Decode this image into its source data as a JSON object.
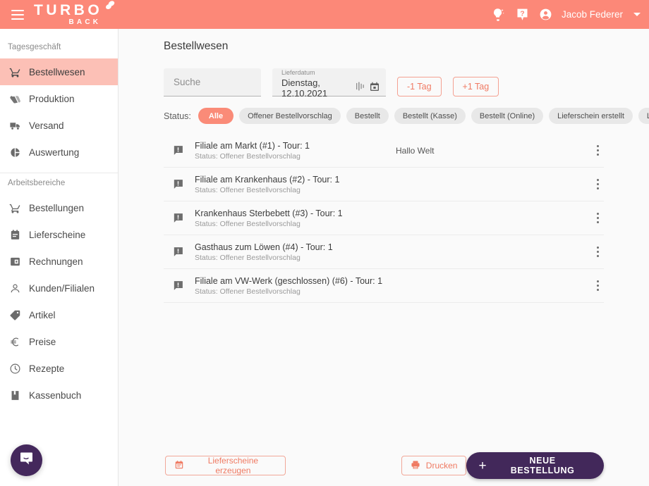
{
  "topbar": {
    "menu_icon": "hamburger-menu-icon",
    "logo_main": "TURBO",
    "logo_sub": "BACK",
    "tips_icon": "lightbulb-icon",
    "help_icon": "help-question-icon",
    "account_icon": "account-circle-icon",
    "username": "Jacob Federer",
    "caret_icon": "chevron-down-icon",
    "bg_color": "#fc8878"
  },
  "sidebar": {
    "groups": [
      {
        "label": "Tagesgeschäft",
        "items": [
          {
            "label": "Bestellwesen",
            "icon": "shopping-cart-icon",
            "active": true
          },
          {
            "label": "Produktion",
            "icon": "production-bread-icon",
            "active": false
          },
          {
            "label": "Versand",
            "icon": "delivery-truck-icon",
            "active": false
          },
          {
            "label": "Auswertung",
            "icon": "pie-chart-icon",
            "active": false
          }
        ]
      },
      {
        "label": "Arbeitsbereiche",
        "items": [
          {
            "label": "Bestellungen",
            "icon": "shopping-cart-icon",
            "active": false
          },
          {
            "label": "Lieferscheine",
            "icon": "delivery-note-icon",
            "active": false
          },
          {
            "label": "Rechnungen",
            "icon": "invoice-icon",
            "active": false
          },
          {
            "label": "Kunden/Filialen",
            "icon": "person-icon",
            "active": false
          },
          {
            "label": "Artikel",
            "icon": "tag-label-icon",
            "active": false
          },
          {
            "label": "Preise",
            "icon": "euro-currency-icon",
            "active": false
          },
          {
            "label": "Rezepte",
            "icon": "clock-icon",
            "active": false
          },
          {
            "label": "Kassenbuch",
            "icon": "book-icon",
            "active": false
          }
        ]
      }
    ],
    "active_bg": "#fcc0b6"
  },
  "main": {
    "title": "Bestellwesen",
    "search": {
      "value": "",
      "placeholder": "Suche",
      "name": "search-input"
    },
    "date": {
      "label": "Lieferdatum",
      "value": "Dienstag, 12.10.2021",
      "resize_icon": "date-picker-toggle-icon",
      "calendar_icon": "calendar-icon"
    },
    "day_buttons": [
      {
        "label": "-1 Tag",
        "name": "previous-day-button"
      },
      {
        "label": "+1 Tag",
        "name": "next-day-button"
      }
    ],
    "status": {
      "label": "Status:",
      "chips": [
        {
          "label": "Alle",
          "active": true
        },
        {
          "label": "Offener Bestellvorschlag",
          "active": false
        },
        {
          "label": "Bestellt",
          "active": false
        },
        {
          "label": "Bestellt (Kasse)",
          "active": false
        },
        {
          "label": "Bestellt (Online)",
          "active": false
        },
        {
          "label": "Lieferschein erstellt",
          "active": false
        },
        {
          "label": "Liefersperre",
          "active": false
        }
      ],
      "active_color": "#fa8b78"
    },
    "rows": [
      {
        "icon": "comment-alert-icon",
        "title": "Filiale am Markt (#1) - Tour: 1",
        "subtitle": "Status: Offener Bestellvorschlag",
        "note": "Hallo Welt",
        "menu_icon": "more-vertical-icon"
      },
      {
        "icon": "comment-alert-icon",
        "title": "Filiale am Krankenhaus (#2) - Tour: 1",
        "subtitle": "Status: Offener Bestellvorschlag",
        "note": "",
        "menu_icon": "more-vertical-icon"
      },
      {
        "icon": "comment-alert-icon",
        "title": "Krankenhaus Sterbebett (#3) - Tour: 1",
        "subtitle": "Status: Offener Bestellvorschlag",
        "note": "",
        "menu_icon": "more-vertical-icon"
      },
      {
        "icon": "comment-alert-icon",
        "title": "Gasthaus zum Löwen (#4) - Tour: 1",
        "subtitle": "Status: Offener Bestellvorschlag",
        "note": "",
        "menu_icon": "more-vertical-icon"
      },
      {
        "icon": "comment-alert-icon",
        "title": "Filiale am VW-Werk (geschlossen) (#6) - Tour: 1",
        "subtitle": "Status: Offener Bestellvorschlag",
        "note": "",
        "menu_icon": "more-vertical-icon"
      }
    ]
  },
  "bottombar": {
    "lieferscheine_label": "Lieferscheine erzeugen",
    "lieferscheine_icon": "delivery-note-icon",
    "drucken_label": "Drucken",
    "drucken_icon": "printer-icon",
    "new_order_label": "NEUE BESTELLUNG",
    "new_order_icon": "plus-icon",
    "new_order_color": "#42285a"
  },
  "chat": {
    "icon": "chat-bubble-smile-icon",
    "color": "#44285c"
  }
}
